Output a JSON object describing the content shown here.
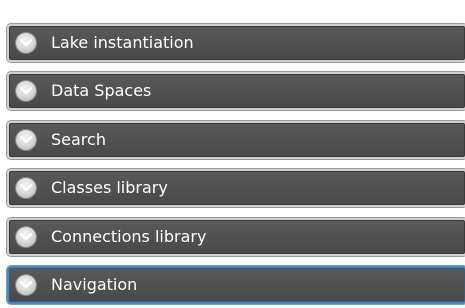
{
  "accordion": {
    "items": [
      {
        "label": "Lake instantiation",
        "icon": "chevron-down-icon"
      },
      {
        "label": "Data Spaces",
        "icon": "chevron-down-icon"
      },
      {
        "label": "Search",
        "icon": "chevron-down-icon"
      },
      {
        "label": "Classes library",
        "icon": "chevron-down-icon"
      },
      {
        "label": "Connections library",
        "icon": "chevron-down-icon"
      },
      {
        "label": "Navigation",
        "icon": "chevron-down-icon",
        "highlighted": true
      }
    ]
  },
  "colors": {
    "row_background": "#505050",
    "row_border": "#cfcfcf",
    "active_border": "#4a86b8",
    "label_text": "#ffffff"
  }
}
